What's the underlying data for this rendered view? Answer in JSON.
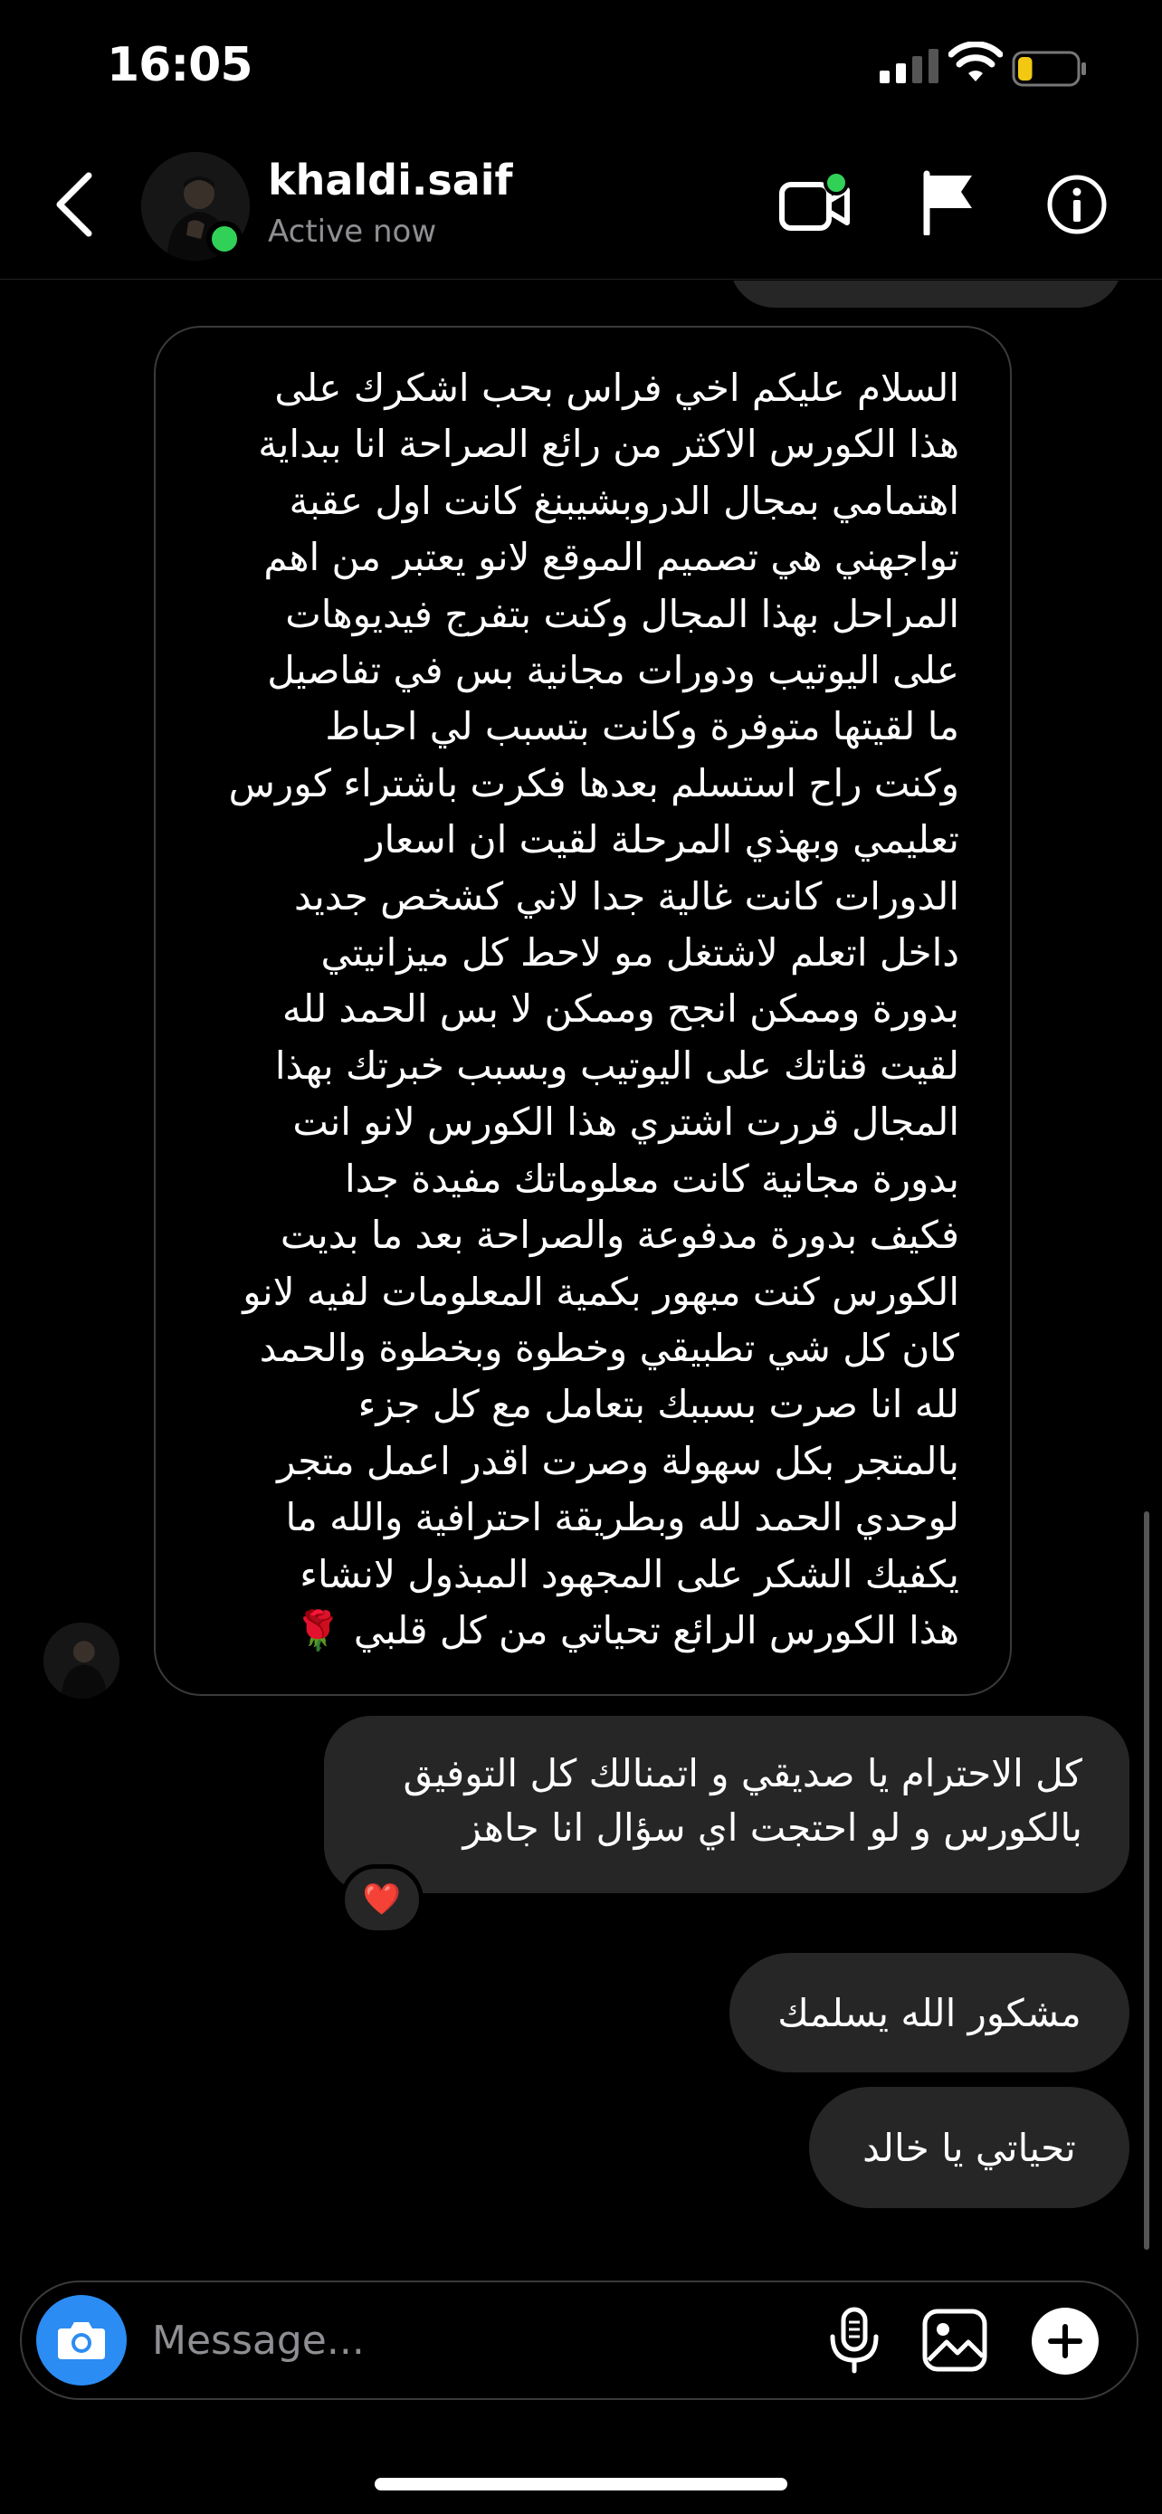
{
  "status_bar": {
    "time": "16:05"
  },
  "header": {
    "username": "khaldi.saif",
    "status": "Active now"
  },
  "messages": {
    "received_1": {
      "lines": [
        "السلام عليكم اخي فراس بحب اشكرك على",
        "هذا الكورس الاكثر من رائع الصراحة انا ببداية",
        "اهتمامي بمجال الدروبشيبنغ كانت اول عقبة",
        "تواجهني هي تصميم الموقع لانو يعتبر من اهم",
        "المراحل بهذا المجال وكنت بتفرج فيديوهات",
        "على اليوتيب ودورات مجانية بس في تفاصيل",
        "ما لقيتها متوفرة وكانت بتسبب لي احباط",
        "وكنت راح استسلم بعدها فكرت باشتراء كورس",
        "تعليمي وبهذي المرحلة لقيت ان اسعار",
        "الدورات كانت غالية جدا لاني كشخص جديد",
        "داخل اتعلم لاشتغل مو لاحط كل ميزانيتي",
        "بدورة وممكن انجح وممكن لا بس الحمد لله",
        "لقيت قناتك على اليوتيب وبسبب خبرتك بهذا",
        "المجال قررت اشتري هذا الكورس لانو انت",
        "بدورة مجانية كانت معلوماتك مفيدة جدا",
        "فكيف بدورة مدفوعة والصراحة بعد ما بديت",
        "الكورس كنت مبهور بكمية المعلومات لفيه لانو",
        "كان كل شي تطبيقي وخطوة وبخطوة والحمد",
        "لله انا صرت بسببك بتعامل مع كل جزء",
        "بالمتجر بكل سهولة وصرت اقدر اعمل متجر",
        "لوحدي الحمد لله وبطريقة احترافية والله ما",
        "يكفيك الشكر على المجهود المبذول لانشاء",
        "هذا الكورس الرائع تحياتي من كل قلبي 🌹"
      ]
    },
    "sent_1": {
      "lines": [
        "كل الاحترام يا صديقي و اتمنالك كل التوفيق",
        "بالكورس و لو احتجت اي سؤال انا جاهز"
      ],
      "reaction": "❤️"
    },
    "sent_2": {
      "text": "مشكور الله يسلمك"
    },
    "sent_3": {
      "text": "تحياتي يا خالد"
    }
  },
  "composer": {
    "placeholder": "Message..."
  },
  "colors": {
    "background": "#000000",
    "bubble_sent": "#262626",
    "bubble_received_border": "#3a3a3c",
    "online": "#31d158",
    "camera_button": "#2b8cf3",
    "battery_level": "#f2c813"
  },
  "battery_level": 0.25
}
